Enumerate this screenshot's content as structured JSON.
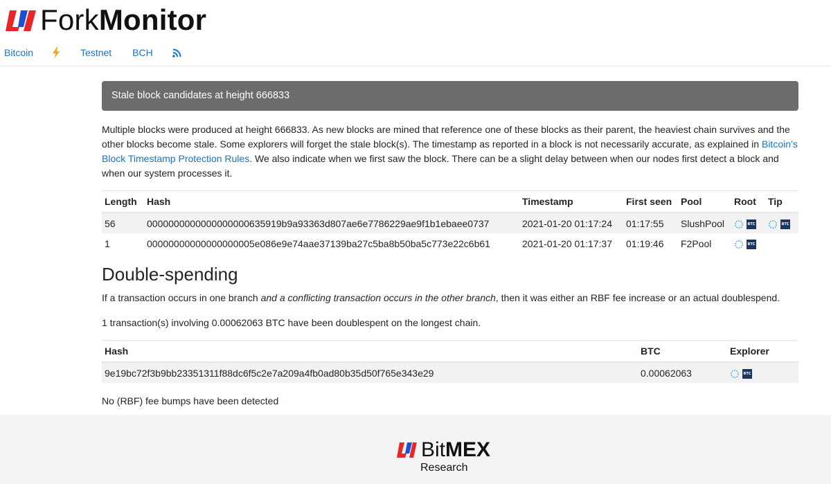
{
  "brand": {
    "fork": "Fork",
    "monitor": "Monitor"
  },
  "nav": {
    "bitcoin": "Bitcoin",
    "testnet": "Testnet",
    "bch": "BCH"
  },
  "banner": "Stale block candidates at height 666833",
  "intro": {
    "before": "Multiple blocks were produced at height 666833. As new blocks are mined that reference one of these blocks as their parent, the heaviest chain survives and the other blocks become stale. Some explorers will forget the stale block(s). The timestamp as reported in a block is not necessarily accurate, as explained in ",
    "link": "Bitcoin’s Block Timestamp Protection Rules",
    "after": ". We also indicate when we first saw the block. There can be a slight delay between when our nodes first detect a block and when our system processes it."
  },
  "blocks_table": {
    "headers": {
      "length": "Length",
      "hash": "Hash",
      "timestamp": "Timestamp",
      "first_seen": "First seen",
      "pool": "Pool",
      "root": "Root",
      "tip": "Tip"
    },
    "rows": [
      {
        "length": "56",
        "hash": "0000000000000000000635919b9a93363d807ae6e7786229ae9f1b1ebaee0737",
        "timestamp": "2021-01-20 01:17:24",
        "first_seen": "01:17:55",
        "pool": "SlushPool",
        "has_tip": true
      },
      {
        "length": "1",
        "hash": "00000000000000000005e086e9e74aae37139ba27c5ba8b50ba5c773e22c6b61",
        "timestamp": "2021-01-20 01:17:37",
        "first_seen": "01:19:46",
        "pool": "F2Pool",
        "has_tip": false
      }
    ]
  },
  "double_spending": {
    "title": "Double-spending",
    "desc_before": "If a transaction occurs in one branch ",
    "desc_em": "and a conflicting transaction occurs in the other branch",
    "desc_after": ", then it was either an RBF fee increase or an actual doublespend.",
    "summary": "1 transaction(s) involving 0.00062063 BTC have been doublespent on the longest chain."
  },
  "tx_table": {
    "headers": {
      "hash": "Hash",
      "btc": "BTC",
      "explorer": "Explorer"
    },
    "rows": [
      {
        "hash": "9e19bc72f3b9bb23351311f88dc6f5c2e7a209a4fb0ad80b35d50f765e343e29",
        "btc": "0.00062063"
      }
    ]
  },
  "no_bumps": "No (RBF) fee bumps have been detected",
  "footer": {
    "bit": "Bit",
    "mex": "MEX",
    "research": "Research"
  },
  "explorer_badge": "BTC",
  "colors": {
    "brand_red": "#e8262a",
    "brand_blue": "#1a4fd6",
    "link": "#1a73c8",
    "bolt": "#f5a623",
    "banner": "#6c6c6c",
    "btc_badge": "#1b3660"
  }
}
